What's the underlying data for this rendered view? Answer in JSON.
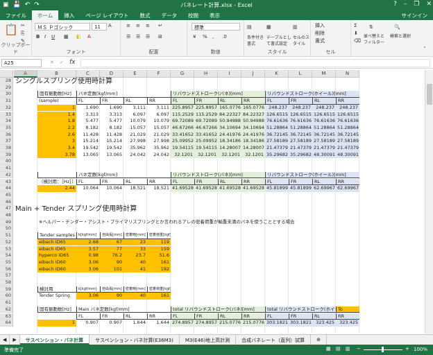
{
  "window": {
    "title": "バネレート計算.xlsx - Excel",
    "signin": "サインイン"
  },
  "ribbon_tabs": [
    "ファイル",
    "ホーム",
    "挿入",
    "ページ レイアウト",
    "数式",
    "データ",
    "校閲",
    "表示"
  ],
  "ribbon": {
    "clipboard": "クリップボード",
    "font_group": "フォント",
    "font_name": "ＭＳ Ｐゴシック",
    "font_size": "11",
    "align_group": "配置",
    "number_group": "数値",
    "number_format": "標準",
    "styles_group": "スタイル",
    "cond_fmt": "条件付き書式",
    "table_fmt": "テーブルとして書式設定",
    "cell_style": "セルのスタイル",
    "cells_group": "セル",
    "insert": "挿入",
    "delete": "削除",
    "format": "書式",
    "edit_group": "編集",
    "sort": "並べ替えとフィルター",
    "find": "検索と選択"
  },
  "formula_bar": {
    "name_box": "A25",
    "fx": "fx"
  },
  "columns": [
    "A",
    "B",
    "C",
    "D",
    "E",
    "F",
    "G",
    "H",
    "I",
    "J",
    "K",
    "L",
    "M",
    "N"
  ],
  "rows": [
    "28",
    "29",
    "30",
    "31",
    "32",
    "33",
    "34",
    "35",
    "36",
    "37",
    "38",
    "39",
    "40",
    "41",
    "42",
    "43",
    "44",
    "45",
    "46",
    "47",
    "48",
    "49",
    "50",
    "51",
    "52",
    "53",
    "54",
    "55",
    "56",
    "57",
    "58",
    "59",
    "60",
    "61",
    "62",
    "63",
    "64"
  ],
  "sec1": {
    "title": "シングルスプリング使用時計算",
    "b_head1": "固有振動数[Hz]",
    "b_head2": "(sample)",
    "c_head": "バネ定数[kgf/mm]",
    "g_head": "リバウンドストローク(バネ)[mm]",
    "k_head": "リバウンドストローク(ホイール)[mm]",
    "sub": [
      "FL",
      "FR",
      "RL",
      "RR",
      "FL",
      "FR",
      "RL",
      "RR",
      "FL",
      "FR",
      "RL",
      "RR"
    ],
    "rows": [
      [
        "1",
        "1.690",
        "1.690",
        "3.111",
        "3.111",
        "225.8957",
        "225.8957",
        "165.0776",
        "165.0776",
        "248.237",
        "248.237",
        "248.237",
        "248.237"
      ],
      [
        "1.4",
        "3.313",
        "3.313",
        "6.097",
        "6.097",
        "115.2529",
        "115.2529",
        "84.22327",
        "84.22327",
        "126.6515",
        "126.6515",
        "126.6515",
        "126.6515"
      ],
      [
        "1.8",
        "5.477",
        "5.477",
        "10.079",
        "10.079",
        "69.72089",
        "69.72089",
        "50.94988",
        "50.94988",
        "76.61636",
        "76.61636",
        "76.61636",
        "76.61636"
      ],
      [
        "2.2",
        "8.182",
        "8.182",
        "15.057",
        "15.057",
        "46.67266",
        "46.67266",
        "34.10694",
        "34.10694",
        "51.28864",
        "51.28864",
        "51.28864",
        "51.28864"
      ],
      [
        "2.6",
        "11.428",
        "11.428",
        "21.029",
        "21.029",
        "33.41652",
        "33.41652",
        "24.41976",
        "24.41976",
        "36.72145",
        "36.72145",
        "36.72145",
        "36.72145"
      ],
      [
        "3",
        "15.214",
        "15.214",
        "27.998",
        "27.998",
        "25.09952",
        "25.09952",
        "18.34186",
        "18.34186",
        "27.58189",
        "27.58189",
        "27.58189",
        "27.58189"
      ],
      [
        "3.4",
        "19.542",
        "19.542",
        "35.962",
        "35.962",
        "19.54115",
        "19.54115",
        "14.28007",
        "14.28007",
        "21.47379",
        "21.47379",
        "21.47379",
        "21.47379"
      ],
      [
        "3.78",
        "13.065",
        "13.065",
        "24.042",
        "24.042",
        "32.1201",
        "32.1201",
        "32.1201",
        "32.1201",
        "35.29682",
        "35.29682",
        "48.30091",
        "48.30091"
      ]
    ],
    "check_label": "（検討用：［Hz］）",
    "check_row": [
      "2.44",
      "10.064",
      "10.064",
      "18.521",
      "18.521",
      "41.69528",
      "41.69528",
      "41.69528",
      "41.69528",
      "45.81899",
      "45.81899",
      "62.69967",
      "62.69967"
    ]
  },
  "sec2": {
    "title": "Main + Tender スプリング使用時計算",
    "note": "※ヘルパー・テンダー・アシスト・プライマリスプリングとか言われるアレの密着荷重が輸重未満のバネを使うこととする場合",
    "tender_head": "Tender samples",
    "tender_cols": [
      "k[kgf/mm]",
      "自由長[mm]",
      "密着時[mm]",
      "密着荷重[kgf]"
    ],
    "tender_rows": [
      [
        "eibach ID65",
        "2.68",
        "67",
        "23",
        "119"
      ],
      [
        "eibach ID65",
        "3.57",
        "77",
        "33",
        "159"
      ],
      [
        "hyperco ID65",
        "0.98",
        "76.2",
        "23.7",
        "51.6"
      ],
      [
        "eibach ID60",
        "3.06",
        "90",
        "40",
        "161"
      ],
      [
        "eibach ID60",
        "3.06",
        "101",
        "41",
        "192"
      ]
    ],
    "check_head": "検討用",
    "check_name": "Tender Spring",
    "check_vals": [
      "3.06",
      "90",
      "40",
      "161"
    ],
    "main_b": "固有振動数[Hz]",
    "main_c": "Main バネ定数[kgf/mm]",
    "main_g": "total リバウンドストローク(バネ)[mm]",
    "main_k": "total リバウンドストローク(ホイール)[mm]",
    "main_n": "To",
    "row64": [
      "1",
      "0.907",
      "0.907",
      "1.644",
      "1.644",
      "274.8957",
      "274.8957",
      "215.0776",
      "215.0776",
      "303.1821",
      "303.1821",
      "323.425",
      "323.425"
    ]
  },
  "sheet_tabs": [
    "サスペンション・バネ計算",
    "サスペンション・バネ計算(E36M3)",
    "M3(E46)地上高計測",
    "合成バネレート（直列）試算"
  ],
  "status": {
    "ready": "準備完了",
    "zoom": "100%"
  }
}
